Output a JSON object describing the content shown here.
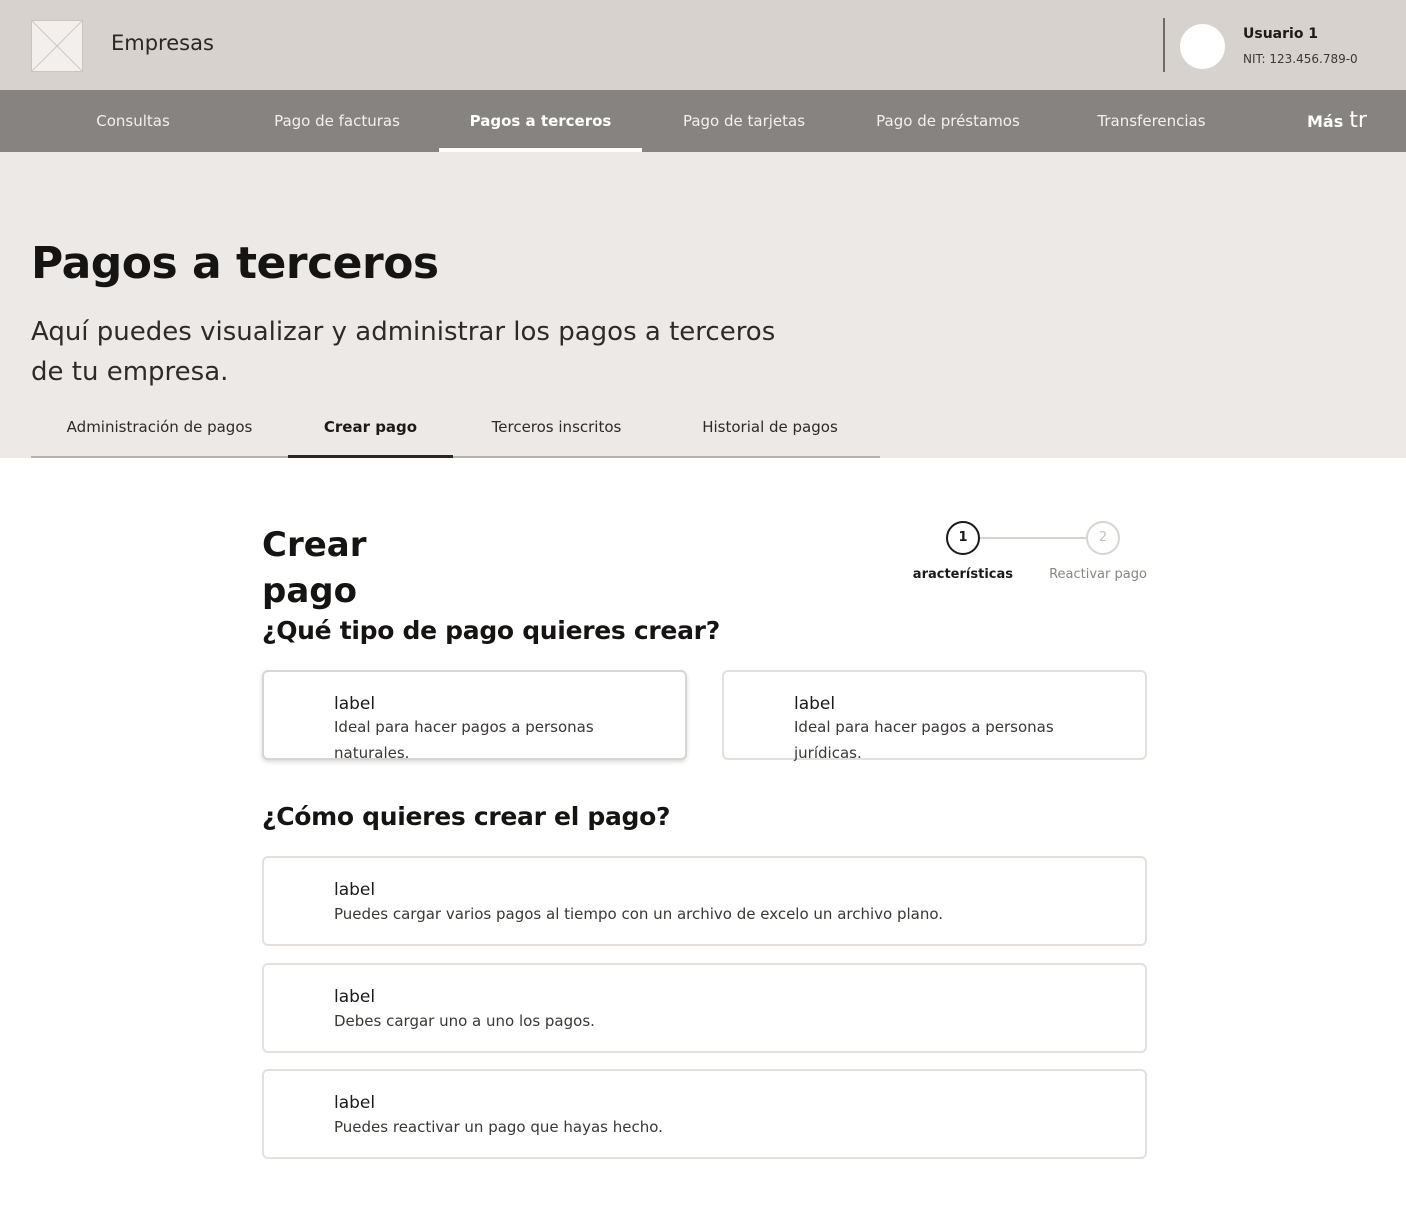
{
  "header": {
    "brand": "Empresas",
    "user_name": "Usuario 1",
    "user_nit": "NIT: 123.456.789-0"
  },
  "nav": {
    "items": [
      {
        "label": "Consultas",
        "active": false
      },
      {
        "label": "Pago de facturas",
        "active": false
      },
      {
        "label": "Pagos a terceros",
        "active": true
      },
      {
        "label": "Pago de tarjetas",
        "active": false
      },
      {
        "label": "Pago de préstamos",
        "active": false
      },
      {
        "label": "Transferencias",
        "active": false
      }
    ],
    "more_label": "Más",
    "more_icon_text": "tr"
  },
  "hero": {
    "title": "Pagos a terceros",
    "subtitle_line1": "Aquí puedes visualizar y administrar los pagos a terceros",
    "subtitle_line2": "de tu empresa.",
    "tabs": [
      {
        "label": "Administración de pagos",
        "active": false
      },
      {
        "label": "Crear pago",
        "active": true
      },
      {
        "label": "Terceros inscritos",
        "active": false
      },
      {
        "label": "Historial de pagos",
        "active": false
      }
    ]
  },
  "main": {
    "title_line1": "Crear",
    "title_line2": "pago",
    "question_type": "¿Qué tipo de pago quieres crear?",
    "question_how": "¿Cómo quieres crear el pago?",
    "stepper": {
      "steps": [
        {
          "number": "1",
          "label": "Características",
          "active": true
        },
        {
          "number": "2",
          "label": "Reactivar pago",
          "active": false
        }
      ]
    },
    "type_options": [
      {
        "label": "label",
        "desc_line1": "Ideal para hacer pagos a personas",
        "desc_line2": "naturales.",
        "selected": true
      },
      {
        "label": "label",
        "desc_line1": "Ideal para hacer pagos a personas",
        "desc_line2": "jurídicas.",
        "selected": false
      }
    ],
    "how_options": [
      {
        "label": "label",
        "desc": "Puedes cargar varios pagos al tiempo con un archivo de excelo un archivo plano."
      },
      {
        "label": "label",
        "desc": "Debes cargar uno a uno los pagos."
      },
      {
        "label": "label",
        "desc": "Puedes reactivar un pago que hayas hecho."
      }
    ]
  }
}
